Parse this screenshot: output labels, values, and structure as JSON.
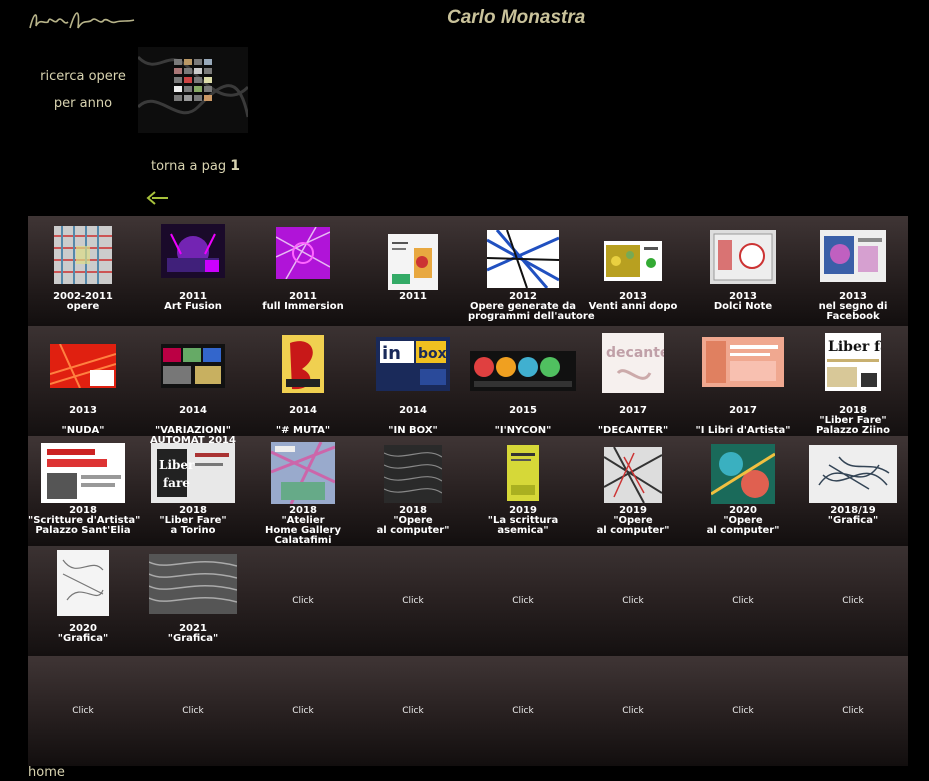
{
  "header": {
    "title": "Carlo Monastra",
    "search_line1": "ricerca opere",
    "search_line2": "per anno",
    "back_text": "torna a pag",
    "back_page": "1"
  },
  "footer": {
    "home": "home"
  },
  "grid": [
    [
      {
        "l1": "2002-2011",
        "l2": "opere",
        "l3": ""
      },
      {
        "l1": "2011",
        "l2": "Art Fusion",
        "l3": ""
      },
      {
        "l1": "2011",
        "l2": "full Immersion",
        "l3": ""
      },
      {
        "l1": "2011",
        "l2": "",
        "l3": ""
      },
      {
        "l1": "2012",
        "l2": "Opere generate da",
        "l3": "programmi dell'autore"
      },
      {
        "l1": "2013",
        "l2": "Venti anni dopo",
        "l3": ""
      },
      {
        "l1": "2013",
        "l2": "Dolci Note",
        "l3": ""
      },
      {
        "l1": "2013",
        "l2": "nel segno di",
        "l3": "Facebook"
      }
    ],
    [
      {
        "l1": "2013",
        "l2": "",
        "l3": "\"NUDA\""
      },
      {
        "l1": "2014",
        "l2": "",
        "l3": "\"VARIAZIONI\"",
        "l4": "AUTOMAT 2014"
      },
      {
        "l1": "2014",
        "l2": "",
        "l3": "\"# MUTA\""
      },
      {
        "l1": "2014",
        "l2": "",
        "l3": "\"IN BOX\""
      },
      {
        "l1": "2015",
        "l2": "",
        "l3": "\"I'NYCON\""
      },
      {
        "l1": "2017",
        "l2": "",
        "l3": "\"DECANTER\""
      },
      {
        "l1": "2017",
        "l2": "",
        "l3": "\"I Libri d'Artista\""
      },
      {
        "l1": "2018",
        "l2": "\"Liber Fare\"",
        "l3": "Palazzo Ziino"
      }
    ],
    [
      {
        "l1": "2018",
        "l2": "\"Scritture d'Artista\"",
        "l3": "Palazzo Sant'Elia"
      },
      {
        "l1": "2018",
        "l2": "\"Liber Fare\"",
        "l3": "a Torino"
      },
      {
        "l1": "2018",
        "l2": "\"Atelier",
        "l3": "Home Gallery",
        "l4": "Calatafimi"
      },
      {
        "l1": "2018",
        "l2": "\"Opere",
        "l3": "al computer\""
      },
      {
        "l1": "2019",
        "l2": "\"La scrittura",
        "l3": "asemica\""
      },
      {
        "l1": "2019",
        "l2": "\"Opere",
        "l3": "al computer\""
      },
      {
        "l1": "2020",
        "l2": "\"Opere",
        "l3": "al computer\""
      },
      {
        "l1": "2018/19",
        "l2": "\"Grafica\"",
        "l3": ""
      }
    ],
    [
      {
        "l1": "2020",
        "l2": "\"Grafica\"",
        "l3": ""
      },
      {
        "l1": "2021",
        "l2": "\"Grafica\"",
        "l3": ""
      },
      {
        "click": "Click"
      },
      {
        "click": "Click"
      },
      {
        "click": "Click"
      },
      {
        "click": "Click"
      },
      {
        "click": "Click"
      },
      {
        "click": "Click"
      }
    ],
    [
      {
        "click": "Click"
      },
      {
        "click": "Click"
      },
      {
        "click": "Click"
      },
      {
        "click": "Click"
      },
      {
        "click": "Click"
      },
      {
        "click": "Click"
      },
      {
        "click": "Click"
      },
      {
        "click": "Click"
      }
    ]
  ]
}
